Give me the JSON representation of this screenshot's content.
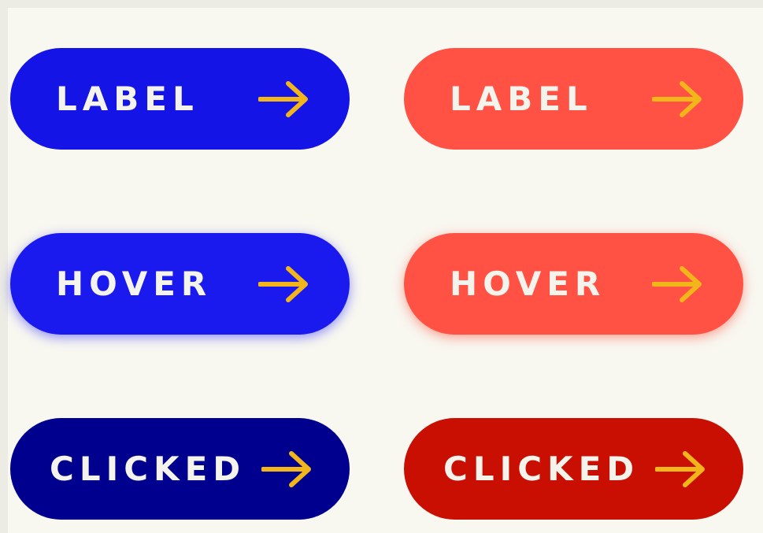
{
  "colors": {
    "blue_default": "#1414e6",
    "blue_hover": "#1a1aee",
    "blue_clicked": "#00008f",
    "red_default": "#ff5244",
    "red_hover": "#ff5244",
    "red_clicked": "#c80f02",
    "arrow": "#f2b61b",
    "text": "#f4f3ec"
  },
  "buttons": {
    "blue_label": {
      "label": "LABEL",
      "icon": "arrow-right-icon",
      "state": "default"
    },
    "red_label": {
      "label": "LABEL",
      "icon": "arrow-right-icon",
      "state": "default"
    },
    "blue_hover": {
      "label": "HOVER",
      "icon": "arrow-right-icon",
      "state": "hover"
    },
    "red_hover": {
      "label": "HOVER",
      "icon": "arrow-right-icon",
      "state": "hover"
    },
    "blue_clicked": {
      "label": "CLICKED",
      "icon": "arrow-right-icon",
      "state": "clicked"
    },
    "red_clicked": {
      "label": "CLICKED",
      "icon": "arrow-right-icon",
      "state": "clicked"
    }
  }
}
